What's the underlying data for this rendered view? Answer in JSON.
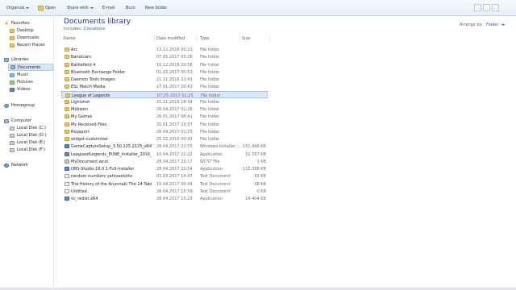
{
  "toolbar": {
    "items": [
      {
        "label": "Organize",
        "has_dropdown": true,
        "icon": ""
      },
      {
        "label": "Open",
        "has_dropdown": false,
        "icon": "folder-icon"
      },
      {
        "label": "Share with",
        "has_dropdown": true,
        "icon": ""
      },
      {
        "label": "E-mail",
        "has_dropdown": false,
        "icon": ""
      },
      {
        "label": "Burn",
        "has_dropdown": false,
        "icon": ""
      },
      {
        "label": "New folder",
        "has_dropdown": false,
        "icon": ""
      }
    ]
  },
  "sidebar": {
    "favorites": {
      "label": "Favorites",
      "items": [
        {
          "label": "Desktop",
          "icon": "desktop-icon"
        },
        {
          "label": "Downloads",
          "icon": "downloads-icon"
        },
        {
          "label": "Recent Places",
          "icon": "recent-places-icon"
        }
      ]
    },
    "libraries": {
      "label": "Libraries",
      "items": [
        {
          "label": "Documents",
          "icon": "documents-icon",
          "selected": true
        },
        {
          "label": "Music",
          "icon": "music-icon"
        },
        {
          "label": "Pictures",
          "icon": "pictures-icon"
        },
        {
          "label": "Videos",
          "icon": "videos-icon"
        }
      ]
    },
    "homegroup": {
      "label": "Homegroup"
    },
    "computer": {
      "label": "Computer",
      "items": [
        {
          "label": "Local Disk (C:)",
          "icon": "disk-icon"
        },
        {
          "label": "Local Disk (D:)",
          "icon": "disk-icon"
        },
        {
          "label": "Local Disk (E:)",
          "icon": "disk-icon"
        },
        {
          "label": "Local Disk (F:)",
          "icon": "disk-icon"
        }
      ]
    },
    "network": {
      "label": "Network"
    }
  },
  "header": {
    "title": "Documents library",
    "includes_prefix": "Includes:",
    "includes_link": "2 locations",
    "arrange_label": "Arrange by:",
    "arrange_value": "Folder"
  },
  "columns": {
    "name": "Name",
    "date": "Date modified",
    "type": "Type",
    "size": "Size"
  },
  "files": [
    {
      "name": "Arc",
      "date": "13.12.2016 00:21",
      "type": "File folder",
      "size": "",
      "icon": "folder"
    },
    {
      "name": "Bandicam",
      "date": "07.05.2017 03:26",
      "type": "File folder",
      "size": "",
      "icon": "folder"
    },
    {
      "name": "Battlefield 4",
      "date": "10.12.2016 20:58",
      "type": "File folder",
      "size": "",
      "icon": "folder"
    },
    {
      "name": "Bluetooth Exchange Folder",
      "date": "01.02.2017 00:53",
      "type": "File folder",
      "size": "",
      "icon": "folder"
    },
    {
      "name": "Daemon Tools Images",
      "date": "21.11.2016 22:41",
      "type": "File folder",
      "size": "",
      "icon": "folder"
    },
    {
      "name": "ESL Match Media",
      "date": "17.01.2017 20:43",
      "type": "File folder",
      "size": "",
      "icon": "folder"
    },
    {
      "name": "League of Legends",
      "date": "07.05.2017 02:25",
      "type": "File folder",
      "size": "",
      "icon": "folder",
      "selected": true
    },
    {
      "name": "Lightshot",
      "date": "21.11.2016 18:34",
      "type": "File folder",
      "size": "",
      "icon": "folder"
    },
    {
      "name": "Mobizen",
      "date": "26.04.2017 01:28",
      "type": "File folder",
      "size": "",
      "icon": "folder"
    },
    {
      "name": "My Games",
      "date": "26.01.2017 08:41",
      "type": "File folder",
      "size": "",
      "icon": "folder"
    },
    {
      "name": "My Received Files",
      "date": "31.01.2017 23:37",
      "type": "File folder",
      "size": "",
      "icon": "folder"
    },
    {
      "name": "Rsupport",
      "date": "26.04.2017 01:25",
      "type": "File folder",
      "size": "",
      "icon": "folder"
    },
    {
      "name": "widget-customizer",
      "date": "25.02.2015 00:43",
      "type": "File folder",
      "size": "",
      "icon": "folder"
    },
    {
      "name": "GameCaptureSetup_3.50.125.2125_x64",
      "date": "28.04.2017 22:55",
      "type": "Windows Installer ...",
      "size": "161.496 KB",
      "icon": "app"
    },
    {
      "name": "LeagueofLegends_EUNE_Installer_2016_1...",
      "date": "10.04.2017 21:22",
      "type": "Application",
      "size": "31.767 KB",
      "icon": "app"
    },
    {
      "name": "MyDocument.wcst",
      "date": "28.04.2017 22:17",
      "type": "WCST File",
      "size": "1 KB",
      "icon": "wcst"
    },
    {
      "name": "OBS-Studio-18.0.1-Full-Installer",
      "date": "28.04.2017 22:54",
      "type": "Application",
      "size": "110.386 KB",
      "icon": "app"
    },
    {
      "name": "random numbers yahtzeelotto",
      "date": "02.03.2017 14:47",
      "type": "Text Document",
      "size": "43 KB",
      "icon": "text"
    },
    {
      "name": "The History of the Anunnaki The 14 Tabl...",
      "date": "10.04.2017 00:44",
      "type": "Text Document",
      "size": "38 KB",
      "icon": "text"
    },
    {
      "name": "Untitled",
      "date": "28.04.2017 15:59",
      "type": "Text Document",
      "size": "0 KB",
      "icon": "text"
    },
    {
      "name": "vc_redist.x64",
      "date": "28.04.2017 15:23",
      "type": "Application",
      "size": "14.404 KB",
      "icon": "app"
    }
  ]
}
